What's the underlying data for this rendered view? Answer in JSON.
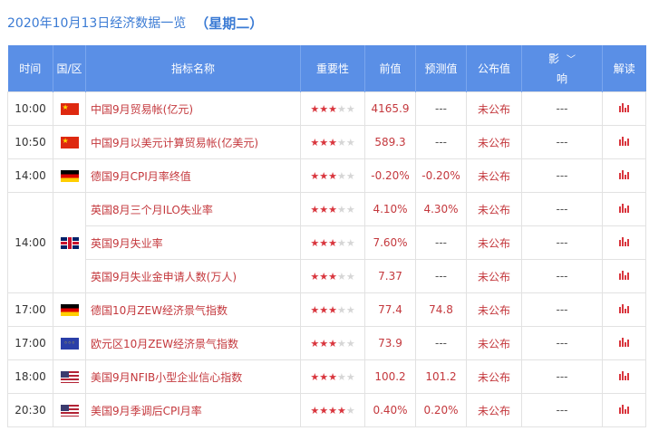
{
  "header": {
    "date_title": "2020年10月13日经济数据一览",
    "weekday": "（星期二）"
  },
  "columns": {
    "time": "时间",
    "country": "国/区",
    "indicator": "指标名称",
    "importance": "重要性",
    "previous": "前值",
    "forecast": "预测值",
    "actual": "公布值",
    "impact_top": "影",
    "impact_bottom": "响",
    "analysis": "解读"
  },
  "icons": {
    "impact_dropdown": "chevron-down-icon",
    "analysis": "bar-chart-icon"
  },
  "colors": {
    "header_bg": "#5a8fe6",
    "accent_red": "#c4383d",
    "title_blue": "#3b7bd4"
  },
  "rows": [
    {
      "time": "10:00",
      "flag": "cn",
      "name": "中国9月贸易帐(亿元)",
      "stars": 3,
      "previous": "4165.9",
      "forecast": "---",
      "actual": "未公布",
      "impact": "---"
    },
    {
      "time": "10:50",
      "flag": "cn",
      "name": "中国9月以美元计算贸易帐(亿美元)",
      "stars": 3,
      "previous": "589.3",
      "forecast": "---",
      "actual": "未公布",
      "impact": "---"
    },
    {
      "time": "14:00",
      "flag": "de",
      "name": "德国9月CPI月率终值",
      "stars": 3,
      "previous": "-0.20%",
      "forecast": "-0.20%",
      "actual": "未公布",
      "impact": "---"
    },
    {
      "time": "14:00",
      "flag": "uk",
      "name": "英国8月三个月ILO失业率",
      "stars": 3,
      "previous": "4.10%",
      "forecast": "4.30%",
      "actual": "未公布",
      "impact": "---",
      "rowspan": 3
    },
    {
      "time": "",
      "flag": "",
      "name": "英国9月失业率",
      "stars": 3,
      "previous": "7.60%",
      "forecast": "---",
      "actual": "未公布",
      "impact": "---",
      "merged": true
    },
    {
      "time": "",
      "flag": "",
      "name": "英国9月失业金申请人数(万人)",
      "stars": 3,
      "previous": "7.37",
      "forecast": "---",
      "actual": "未公布",
      "impact": "---",
      "merged": true
    },
    {
      "time": "17:00",
      "flag": "de",
      "name": "德国10月ZEW经济景气指数",
      "stars": 3,
      "previous": "77.4",
      "forecast": "74.8",
      "actual": "未公布",
      "impact": "---"
    },
    {
      "time": "17:00",
      "flag": "eu",
      "name": "欧元区10月ZEW经济景气指数",
      "stars": 3,
      "previous": "73.9",
      "forecast": "---",
      "actual": "未公布",
      "impact": "---"
    },
    {
      "time": "18:00",
      "flag": "us",
      "name": "美国9月NFIB小型企业信心指数",
      "stars": 3,
      "previous": "100.2",
      "forecast": "101.2",
      "actual": "未公布",
      "impact": "---"
    },
    {
      "time": "20:30",
      "flag": "us",
      "name": "美国9月季调后CPI月率",
      "stars": 4,
      "previous": "0.40%",
      "forecast": "0.20%",
      "actual": "未公布",
      "impact": "---"
    }
  ]
}
